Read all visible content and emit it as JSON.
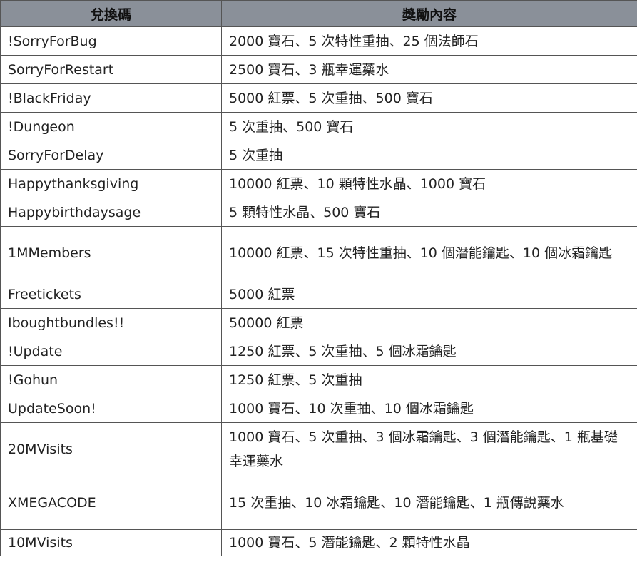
{
  "header": {
    "code": "兌換碼",
    "reward": "獎勵內容"
  },
  "rows": [
    {
      "code": "!SorryForBug",
      "reward": "2000 寶石、5 次特性重抽、25 個法師石"
    },
    {
      "code": "SorryForRestart",
      "reward": "2500 寶石、3 瓶幸運藥水"
    },
    {
      "code": "!BlackFriday",
      "reward": "5000 紅票、5 次重抽、500 寶石"
    },
    {
      "code": "!Dungeon",
      "reward": "5 次重抽、500 寶石"
    },
    {
      "code": "SorryForDelay",
      "reward": "5 次重抽"
    },
    {
      "code": "Happythanksgiving",
      "reward": "10000 紅票、10 顆特性水晶、1000 寶石"
    },
    {
      "code": "Happybirthdaysage",
      "reward": "5 顆特性水晶、500 寶石"
    },
    {
      "code": "1MMembers",
      "reward": "10000 紅票、15 次特性重抽、10 個潛能鑰匙、10 個冰霜鑰匙"
    },
    {
      "code": "Freetickets",
      "reward": "5000 紅票"
    },
    {
      "code": "Iboughtbundles!!",
      "reward": "50000 紅票"
    },
    {
      "code": "!Update",
      "reward": "1250 紅票、5 次重抽、5 個冰霜鑰匙"
    },
    {
      "code": "!Gohun",
      "reward": "1250 紅票、5 次重抽"
    },
    {
      "code": "UpdateSoon!",
      "reward": "1000 寶石、10 次重抽、10 個冰霜鑰匙"
    },
    {
      "code": "20MVisits",
      "reward": "1000 寶石、5 次重抽、3 個冰霜鑰匙、3 個潛能鑰匙、1 瓶基礎幸運藥水"
    },
    {
      "code": "XMEGACODE",
      "reward": "15 次重抽、10 冰霜鑰匙、10 潛能鑰匙、1 瓶傳說藥水"
    },
    {
      "code": "10MVisits",
      "reward": "1000 寶石、5 潛能鑰匙、2 顆特性水晶"
    }
  ]
}
